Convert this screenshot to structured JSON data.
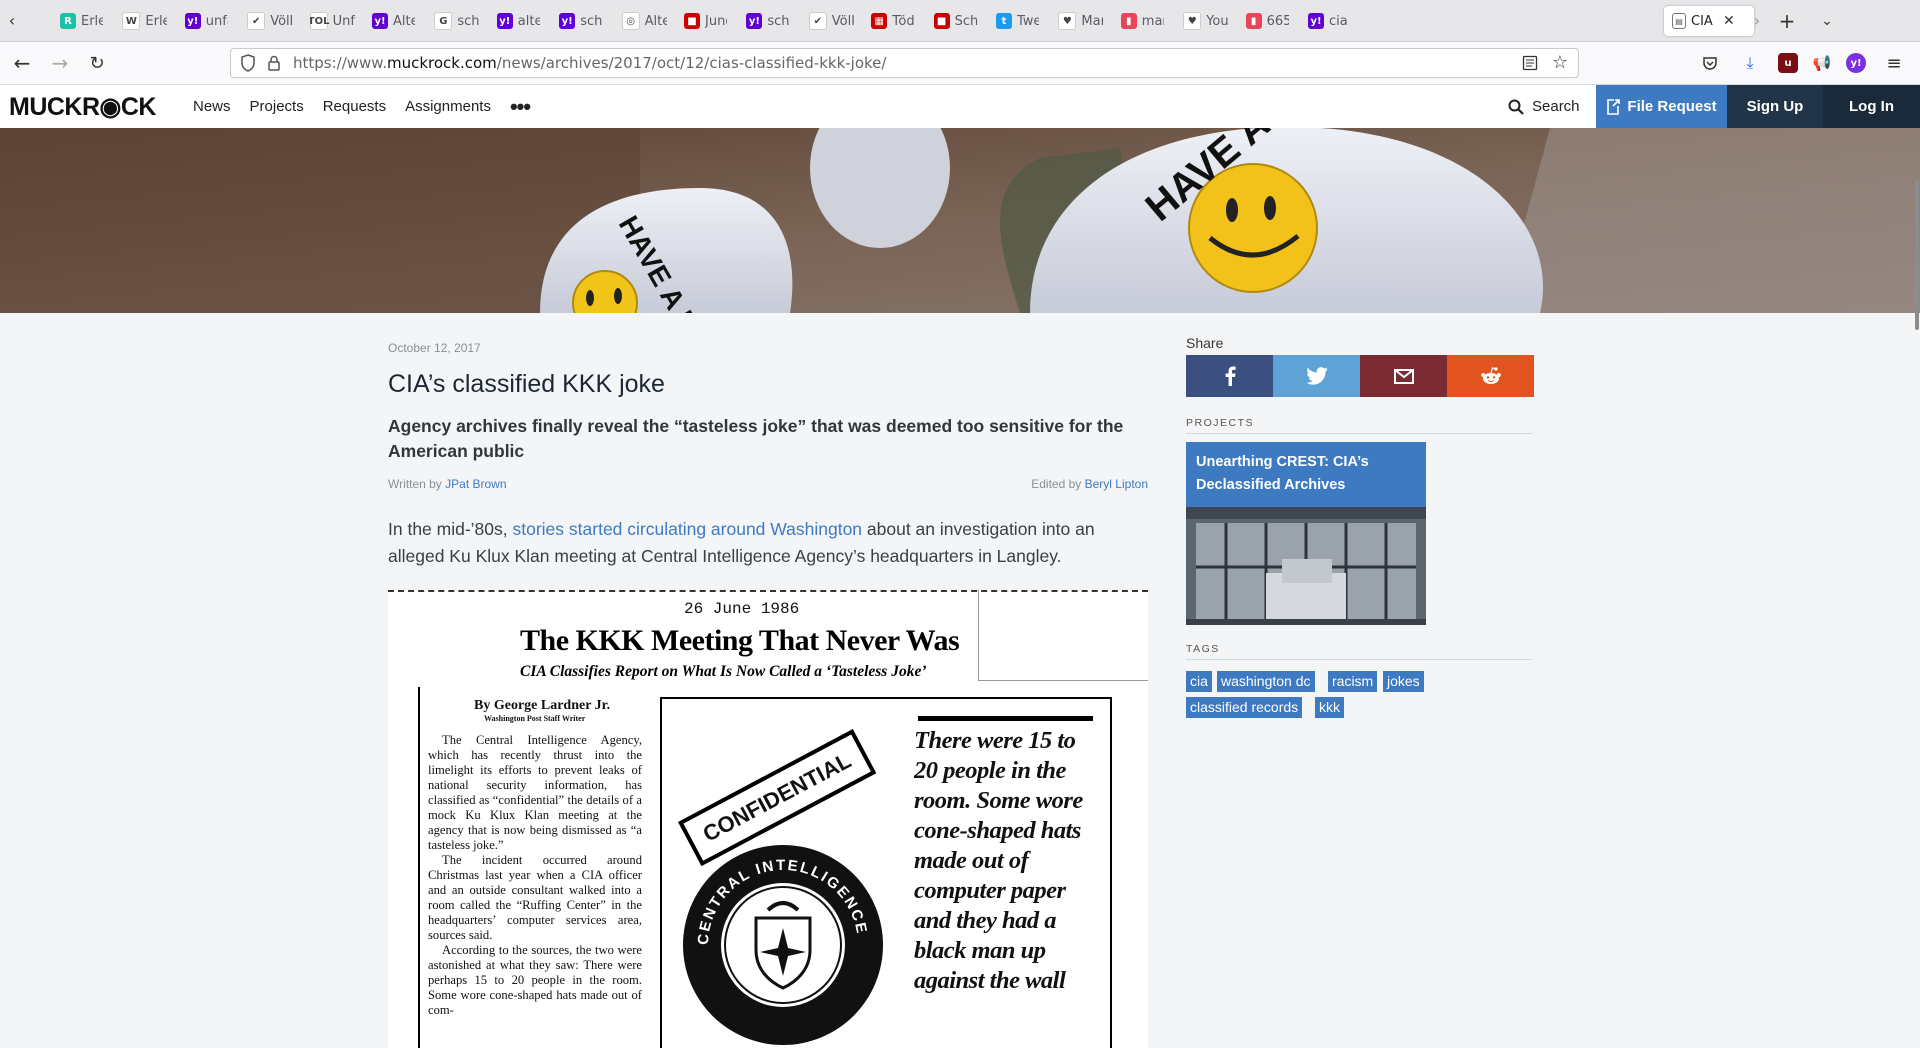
{
  "browser": {
    "tabs": [
      {
        "title": "Erlen",
        "favicon_color": "#1bc2a3",
        "glyph": "R"
      },
      {
        "title": "Erlen",
        "favicon_color": "#ffffff",
        "glyph": "W"
      },
      {
        "title": "unfal",
        "favicon_color": "#6001d2",
        "glyph": "y!"
      },
      {
        "title": "Völki",
        "favicon_color": "#ffffff",
        "glyph": "✔"
      },
      {
        "title": "Unfa",
        "favicon_color": "#ffffff",
        "glyph": "TOL"
      },
      {
        "title": "Alter",
        "favicon_color": "#6001d2",
        "glyph": "y!"
      },
      {
        "title": "schw",
        "favicon_color": "#ffffff",
        "glyph": "G"
      },
      {
        "title": "alter",
        "favicon_color": "#6001d2",
        "glyph": "y!"
      },
      {
        "title": "scha",
        "favicon_color": "#6001d2",
        "glyph": "y!"
      },
      {
        "title": "Alter",
        "favicon_color": "#ffffff",
        "glyph": "◎"
      },
      {
        "title": "Jung",
        "favicon_color": "#cc0000",
        "glyph": "■"
      },
      {
        "title": "schw",
        "favicon_color": "#6001d2",
        "glyph": "y!"
      },
      {
        "title": "Völki",
        "favicon_color": "#ffffff",
        "glyph": "✔"
      },
      {
        "title": "Tödl",
        "favicon_color": "#cc0000",
        "glyph": "▦"
      },
      {
        "title": "Schw",
        "favicon_color": "#cc0000",
        "glyph": "■"
      },
      {
        "title": "Twee",
        "favicon_color": "#1d9bf0",
        "glyph": "t"
      },
      {
        "title": "Marc",
        "favicon_color": "#ffffff",
        "glyph": "♥"
      },
      {
        "title": "marc",
        "favicon_color": "#e8445a",
        "glyph": "▮"
      },
      {
        "title": "Your",
        "favicon_color": "#ffffff",
        "glyph": "♥"
      },
      {
        "title": "6656",
        "favicon_color": "#e8445a",
        "glyph": "▮"
      },
      {
        "title": "cia k",
        "favicon_color": "#6001d2",
        "glyph": "y!"
      }
    ],
    "active_tab": {
      "title": "CIA"
    },
    "url_prefix": "https://www.",
    "url_domain": "muckrock.com",
    "url_path": "/news/archives/2017/oct/12/cias-classified-kkk-joke/"
  },
  "site": {
    "logo": "MUCKR◉CK",
    "nav": [
      "News",
      "Projects",
      "Requests",
      "Assignments"
    ],
    "more": "•••",
    "search": "Search",
    "file_request": "File Request",
    "sign_up": "Sign Up",
    "log_in": "Log In"
  },
  "hero": {
    "text_left": "HAVE A NICE DAY",
    "text_right": "HAVE A NICE DAY"
  },
  "article": {
    "date": "October 12, 2017",
    "title": "CIA’s classified KKK joke",
    "subtitle": "Agency archives finally reveal the “tasteless joke” that was deemed too sensitive for the American public",
    "written_by_label": "Written by ",
    "author": "JPat Brown",
    "edited_by_label": "Edited by ",
    "editor": "Beryl Lipton",
    "lede_before": "In the mid-’80s, ",
    "lede_link": "stories started circulating around Washington",
    "lede_after": " about an investigation into an alleged Ku Klux Klan meeting at Central Intelligence Agency’s headquarters in Langley."
  },
  "clipping": {
    "date": "26 June 1986",
    "headline": "The KKK Meeting That Never Was",
    "deck": "CIA Classifies Report on What Is Now Called a ‘Tasteless Joke’",
    "byline": "By George Lardner Jr.",
    "byline_sub": "Washington Post Staff Writer",
    "para1": "The Central Intelligence Agency, which has recently thrust into the limelight its efforts to prevent leaks of national security information, has classified as “confidential” the details of a mock Ku Klux Klan meeting at the agency that is now being dismissed as “a tasteless joke.”",
    "para2": "The incident occurred around Christmas last year when a CIA officer and an outside consultant walked into a room called the “Ruffing Center” in the headquarters’ computer services area, sources said.",
    "para3": "According to the sources, the two were astonished at what they saw: There were perhaps 15 to 20 people in the room. Some wore cone-shaped hats made out of com-",
    "stamp": "CONFIDENTIAL",
    "seal_text": "CENTRAL INTELLIGENCE AGENCY",
    "pullquote": "There were 15 to 20 people in the room. Some wore cone-shaped hats made out of computer paper and they had a black man up against the wall"
  },
  "sidebar": {
    "share_label": "Share",
    "share_buttons": [
      {
        "name": "facebook",
        "color": "#3b5080"
      },
      {
        "name": "twitter",
        "color": "#5fa3d6"
      },
      {
        "name": "email",
        "color": "#7a2b33"
      },
      {
        "name": "reddit",
        "color": "#e2541f"
      }
    ],
    "projects_label": "PROJECTS",
    "project_title": "Unearthing CREST: CIA’s Declassified Archives",
    "tags_label": "TAGS",
    "tags": [
      "cia",
      "washington dc",
      "racism",
      "jokes",
      "classified records",
      "kkk"
    ]
  },
  "colors": {
    "accent": "#3e7ac1",
    "signup_bg": "#223447",
    "login_bg": "#1a2a3a"
  }
}
